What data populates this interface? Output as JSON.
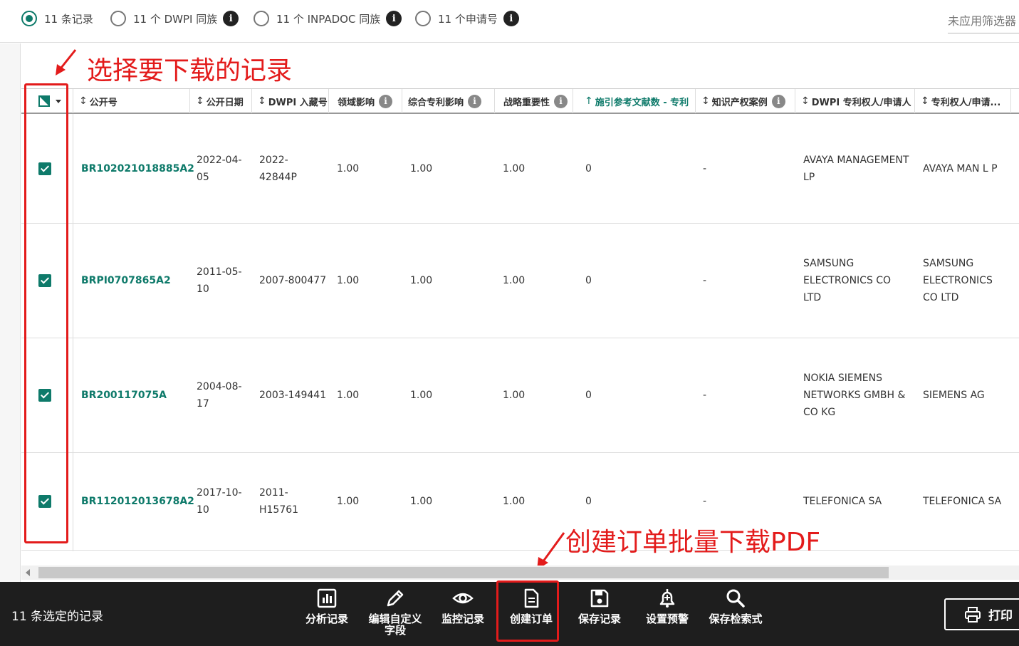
{
  "radios": [
    {
      "label": "11 条记录",
      "selected": true,
      "info": false
    },
    {
      "label": "11 个 DWPI 同族",
      "selected": false,
      "info": true
    },
    {
      "label": "11 个 INPADOC 同族",
      "selected": false,
      "info": true
    },
    {
      "label": "11 个申请号",
      "selected": false,
      "info": true
    }
  ],
  "info_glyph": "i",
  "filter_text": "未应用筛选器",
  "annotations": {
    "select_records": "选择要下载的记录",
    "create_order": "创建订单批量下载PDF"
  },
  "columns": [
    {
      "label": "公开号",
      "sortable": true,
      "info": false,
      "teal": false
    },
    {
      "label": "公开日期",
      "sortable": true,
      "info": false,
      "teal": false
    },
    {
      "label": "DWPI 入藏号",
      "sortable": true,
      "info": false,
      "teal": false
    },
    {
      "label": "领域影响",
      "sortable": false,
      "info": true,
      "teal": false
    },
    {
      "label": "综合专利影响",
      "sortable": false,
      "info": true,
      "teal": false
    },
    {
      "label": "战略重要性",
      "sortable": false,
      "info": true,
      "teal": false
    },
    {
      "label": "施引参考文献数 - 专利",
      "sortable": true,
      "info": false,
      "teal": true
    },
    {
      "label": "知识产权案例",
      "sortable": true,
      "info": true,
      "teal": false
    },
    {
      "label": "DWPI 专利权人/申请人",
      "sortable": true,
      "info": false,
      "teal": false
    },
    {
      "label": "专利权人/申请...",
      "sortable": true,
      "info": false,
      "teal": false
    }
  ],
  "rows": [
    {
      "checked": true,
      "pub": "BR102021018885A2",
      "date_l1": "2022-04-",
      "date_l2": "05",
      "dwpi_l1": "2022-",
      "dwpi_l2": "42844P",
      "domain": "1.00",
      "combined": "1.00",
      "strategic": "1.00",
      "citing": "0",
      "ip": "-",
      "dwpi_assignee": [
        "AVAYA MANAGEMENT",
        "LP"
      ],
      "assignee": [
        "AVAYA MAN L P"
      ]
    },
    {
      "checked": true,
      "pub": "BRPI0707865A2",
      "date_l1": "2011-05-",
      "date_l2": "10",
      "dwpi_l1": "2007-800477",
      "dwpi_l2": "",
      "domain": "1.00",
      "combined": "1.00",
      "strategic": "1.00",
      "citing": "0",
      "ip": "-",
      "dwpi_assignee": [
        "SAMSUNG",
        "ELECTRONICS CO",
        "LTD"
      ],
      "assignee": [
        "SAMSUNG",
        "ELECTRONICS",
        "CO LTD"
      ]
    },
    {
      "checked": true,
      "pub": "BR200117075A",
      "date_l1": "2004-08-",
      "date_l2": "17",
      "dwpi_l1": "2003-149441",
      "dwpi_l2": "",
      "domain": "1.00",
      "combined": "1.00",
      "strategic": "1.00",
      "citing": "0",
      "ip": "-",
      "dwpi_assignee": [
        "NOKIA SIEMENS",
        "NETWORKS GMBH &",
        "CO KG"
      ],
      "assignee": [
        "SIEMENS AG"
      ]
    },
    {
      "checked": true,
      "pub": "BR112012013678A2",
      "date_l1": "2017-10-",
      "date_l2": "10",
      "dwpi_l1": "2011-",
      "dwpi_l2": "H15761",
      "domain": "1.00",
      "combined": "1.00",
      "strategic": "1.00",
      "citing": "0",
      "ip": "-",
      "dwpi_assignee": [
        "TELEFONICA SA"
      ],
      "assignee": [
        "TELEFONICA SA"
      ]
    }
  ],
  "selection_text": "11  条选定的记录",
  "actions": [
    {
      "label": "分析记录",
      "icon": "bar-chart-icon"
    },
    {
      "label": "编辑自定义字段",
      "icon": "pencil-icon"
    },
    {
      "label": "监控记录",
      "icon": "eye-icon"
    },
    {
      "label": "创建订单",
      "icon": "document-icon"
    },
    {
      "label": "保存记录",
      "icon": "save-icon"
    },
    {
      "label": "设置预警",
      "icon": "bell-plus-icon"
    },
    {
      "label": "保存检索式",
      "icon": "search-icon"
    }
  ],
  "print_label": "打印",
  "colors": {
    "teal": "#0e7a6a",
    "annotation_red": "#e31b1b",
    "bar_bg": "#1e1e1e"
  }
}
